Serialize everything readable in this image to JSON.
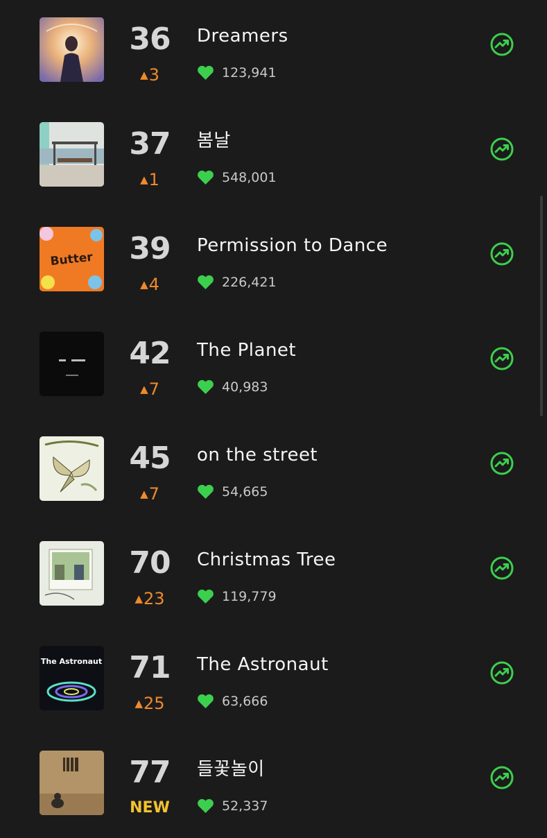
{
  "colors": {
    "background": "#1b1b1b",
    "rank": "#d6d6d6",
    "rank_up": "#ef8a2c",
    "new_badge": "#f2c230",
    "heart": "#3ccf4e",
    "trend_icon": "#3ccf4e",
    "title": "#f5f5f5",
    "likes": "#c9c9c9"
  },
  "icons": {
    "like": "heart-icon",
    "trend": "trending-up-circle-icon",
    "change_up": "up-triangle-icon"
  },
  "songs": [
    {
      "rank": "36",
      "change": "3",
      "change_type": "up",
      "title": "Dreamers",
      "likes": "123,941",
      "cover": "dreamers-cover"
    },
    {
      "rank": "37",
      "change": "1",
      "change_type": "up",
      "title": "봄날",
      "likes": "548,001",
      "cover": "bus-stop-cover"
    },
    {
      "rank": "39",
      "change": "4",
      "change_type": "up",
      "title": "Permission to Dance",
      "likes": "226,421",
      "cover": "butter-cover",
      "cover_text": "Butter"
    },
    {
      "rank": "42",
      "change": "7",
      "change_type": "up",
      "title": "The Planet",
      "likes": "40,983",
      "cover": "dark-cover"
    },
    {
      "rank": "45",
      "change": "7",
      "change_type": "up",
      "title": "on the street",
      "likes": "54,665",
      "cover": "butterfly-cover"
    },
    {
      "rank": "70",
      "change": "23",
      "change_type": "up",
      "title": "Christmas Tree",
      "likes": "119,779",
      "cover": "christmas-tree-cover"
    },
    {
      "rank": "71",
      "change": "25",
      "change_type": "up",
      "title": "The Astronaut",
      "likes": "63,666",
      "cover": "astronaut-cover",
      "cover_text": "The Astronaut"
    },
    {
      "rank": "77",
      "change": "NEW",
      "change_type": "new",
      "title": "들꽃놀이",
      "likes": "52,337",
      "cover": "room-cover"
    }
  ]
}
